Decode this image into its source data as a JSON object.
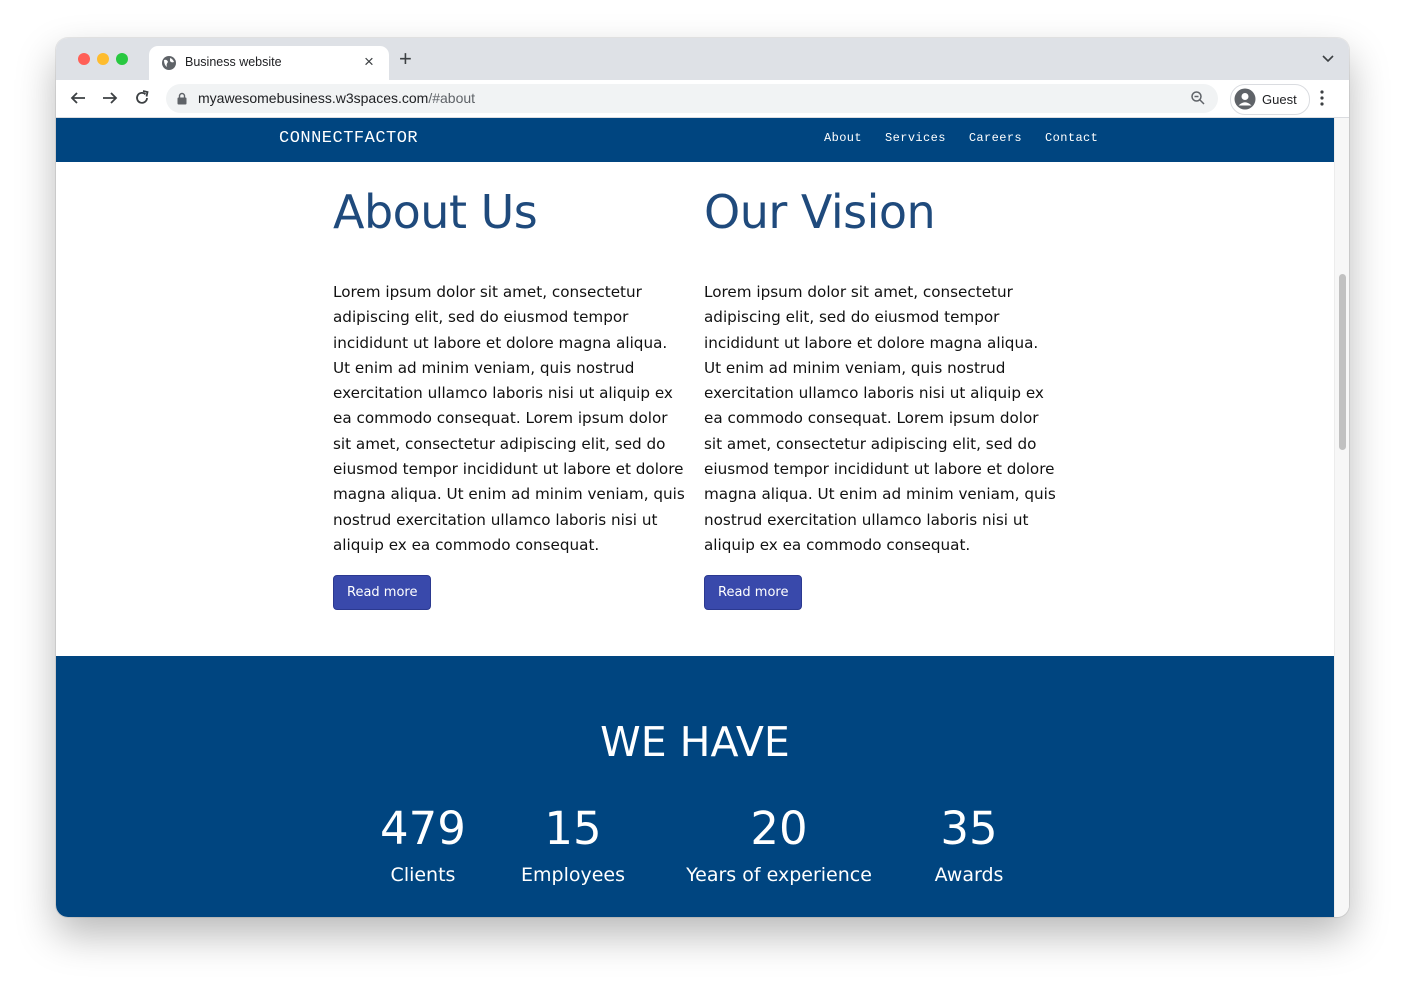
{
  "browser": {
    "tab_title": "Business website",
    "url_host": "myawesomebusiness.w3spaces.com",
    "url_path": "/#about",
    "profile_label": "Guest"
  },
  "site": {
    "brand": "CONNECTFACTOR",
    "nav": [
      "About",
      "Services",
      "Careers",
      "Contact"
    ],
    "colors": {
      "navbar": "#004580",
      "heading": "#1f4a7c",
      "button": "#3949ab"
    }
  },
  "about": {
    "title": "About Us",
    "body": "Lorem ipsum dolor sit amet, consectetur adipiscing elit, sed do eiusmod tempor incididunt ut labore et dolore magna aliqua. Ut enim ad minim veniam, quis nostrud exercitation ullamco laboris nisi ut aliquip ex ea commodo consequat. Lorem ipsum dolor sit amet, consectetur adipiscing elit, sed do eiusmod tempor incididunt ut labore et dolore magna aliqua. Ut enim ad minim veniam, quis nostrud exercitation ullamco laboris nisi ut aliquip ex ea commodo consequat.",
    "button": "Read more"
  },
  "vision": {
    "title": "Our Vision",
    "body": "Lorem ipsum dolor sit amet, consectetur adipiscing elit, sed do eiusmod tempor incididunt ut labore et dolore magna aliqua. Ut enim ad minim veniam, quis nostrud exercitation ullamco laboris nisi ut aliquip ex ea commodo consequat. Lorem ipsum dolor sit amet, consectetur adipiscing elit, sed do eiusmod tempor incididunt ut labore et dolore magna aliqua. Ut enim ad minim veniam, quis nostrud exercitation ullamco laboris nisi ut aliquip ex ea commodo consequat.",
    "button": "Read more"
  },
  "stats": {
    "title": "WE HAVE",
    "items": [
      {
        "number": "479",
        "label": "Clients"
      },
      {
        "number": "15",
        "label": "Employees"
      },
      {
        "number": "20",
        "label": "Years of experience"
      },
      {
        "number": "35",
        "label": "Awards"
      }
    ]
  }
}
